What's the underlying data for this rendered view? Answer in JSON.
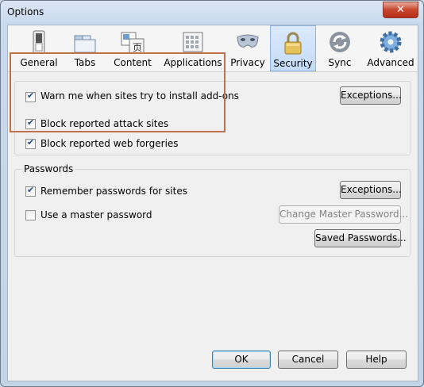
{
  "window": {
    "title": "Options",
    "close_glyph": "✕"
  },
  "tabs": [
    {
      "label": "General",
      "icon": "switch-icon"
    },
    {
      "label": "Tabs",
      "icon": "tabs-icon"
    },
    {
      "label": "Content",
      "icon": "content-icon"
    },
    {
      "label": "Applications",
      "icon": "applications-icon"
    },
    {
      "label": "Privacy",
      "icon": "mask-icon"
    },
    {
      "label": "Security",
      "icon": "padlock-icon",
      "selected": true
    },
    {
      "label": "Sync",
      "icon": "sync-icon"
    },
    {
      "label": "Advanced",
      "icon": "gear-icon"
    }
  ],
  "security": {
    "warn_addons": {
      "label": "Warn me when sites try to install add-ons",
      "checked": true
    },
    "exceptions_button": "Exceptions...",
    "block_attack": {
      "label": "Block reported attack sites",
      "checked": true
    },
    "block_forgeries": {
      "label": "Block reported web forgeries",
      "checked": true
    }
  },
  "passwords": {
    "group_label": "Passwords",
    "remember": {
      "label": "Remember passwords for sites",
      "checked": true
    },
    "exceptions_button": "Exceptions...",
    "master": {
      "label": "Use a master password",
      "checked": false
    },
    "change_master_button": "Change Master Password...",
    "saved_button": "Saved Passwords..."
  },
  "buttons": {
    "ok": "OK",
    "cancel": "Cancel",
    "help": "Help"
  },
  "colors": {
    "highlight": "#c0714a",
    "selected_tab": "#c4dcf7",
    "close_button": "#c7452c"
  }
}
